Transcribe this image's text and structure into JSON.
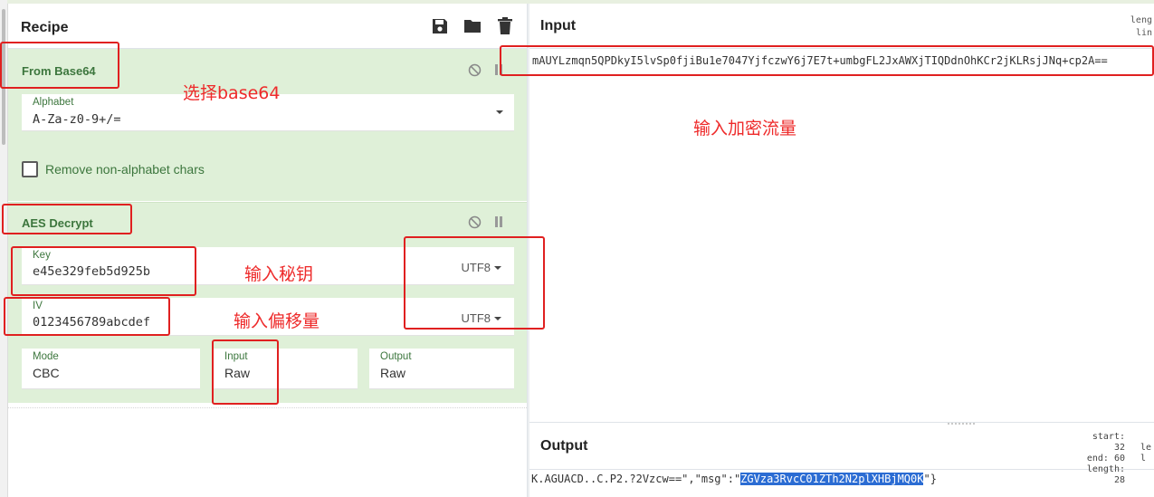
{
  "recipe": {
    "title": "Recipe",
    "icons": [
      "save-icon",
      "folder-icon",
      "trash-icon"
    ],
    "operations": [
      {
        "name": "From Base64",
        "alphabet_label": "Alphabet",
        "alphabet_value": "A-Za-z0-9+/=",
        "remove_label": "Remove non-alphabet chars"
      },
      {
        "name": "AES Decrypt",
        "key_label": "Key",
        "key_value": "e45e329feb5d925b",
        "key_encoding": "UTF8",
        "iv_label": "IV",
        "iv_value": "0123456789abcdef",
        "iv_encoding": "UTF8",
        "mode_label": "Mode",
        "mode_value": "CBC",
        "input_label": "Input",
        "input_value": "Raw",
        "output_label": "Output",
        "output_value": "Raw"
      }
    ]
  },
  "input": {
    "title": "Input",
    "meta_line1": "leng",
    "meta_line2": "lin",
    "text": "mAUYLzmqn5QPDkyI5lvSp0fjiBu1e7047YjfczwY6j7E7t+umbgFL2JxAWXjTIQDdnOhKCr2jKLRsjJNq+cp2A=="
  },
  "output": {
    "title": "Output",
    "start": "start: 32",
    "end": "end: 60",
    "length": "length: 28",
    "side1": "le",
    "side2": "l",
    "text_before": "K.AGUACD..C.P2.?2Vzcw==\",\"msg\":\"",
    "text_highlight": "ZGVza3RvcC01ZTh2N2plXHBjMQ0K",
    "text_after": "\"}"
  },
  "annotations": {
    "base64": "选择base64",
    "traffic": "输入加密流量",
    "key": "输入秘钥",
    "iv": "输入偏移量"
  },
  "colors": {
    "op_background": "#dff0d8",
    "op_text": "#3c763d",
    "highlight": "#2b6cd3",
    "annotation": "#e02020"
  }
}
